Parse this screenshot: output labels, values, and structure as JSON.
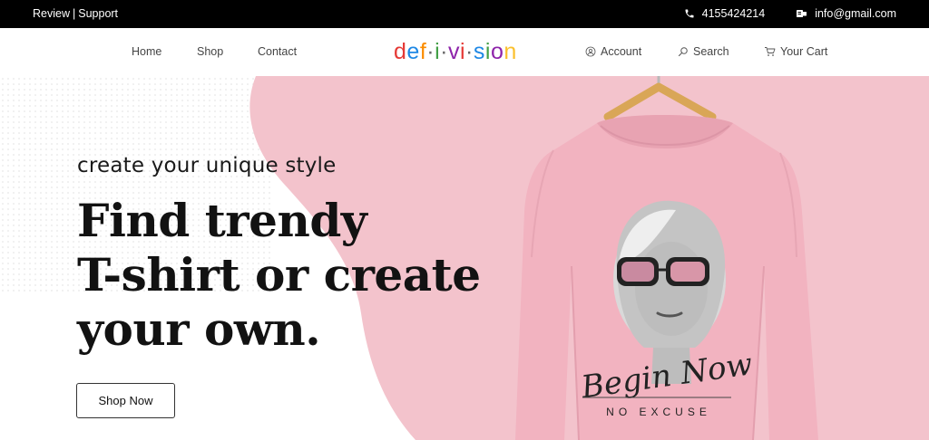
{
  "topbar": {
    "review_label": "Review",
    "separator": "|",
    "support_label": "Support",
    "phone": "4155424214",
    "email": "info@gmail.com",
    "phone_icon": "phone-icon",
    "email_icon": "email-card-icon"
  },
  "nav": {
    "links": [
      "Home",
      "Shop",
      "Contact"
    ],
    "logo_letters": [
      "d",
      "e",
      "f",
      "·",
      "i",
      "·",
      "v",
      "i",
      "·",
      "s",
      "i",
      "o",
      "n"
    ],
    "logo_colors": [
      "#e53935",
      "#1e88e5",
      "#fb8c00",
      "#666666",
      "#43a047",
      "#666666",
      "#8e24aa",
      "#e53935",
      "#666666",
      "#1e88e5",
      "#43a047",
      "#8e24aa",
      "#fbc02d"
    ],
    "account_label": "Account",
    "search_label": "Search",
    "cart_label": "Your Cart"
  },
  "hero": {
    "tagline": "create your unique style",
    "headline_lines": [
      "Find trendy",
      "T-shirt or create",
      "your own."
    ],
    "cta_label": "Shop Now",
    "print_script": "Begin Now",
    "print_caption": "NO EXCUSE"
  },
  "colors": {
    "pink": "#f3c3cc",
    "shirt_pink": "#f2b3c0",
    "hanger": "#d9a657",
    "topbar": "#000000"
  }
}
